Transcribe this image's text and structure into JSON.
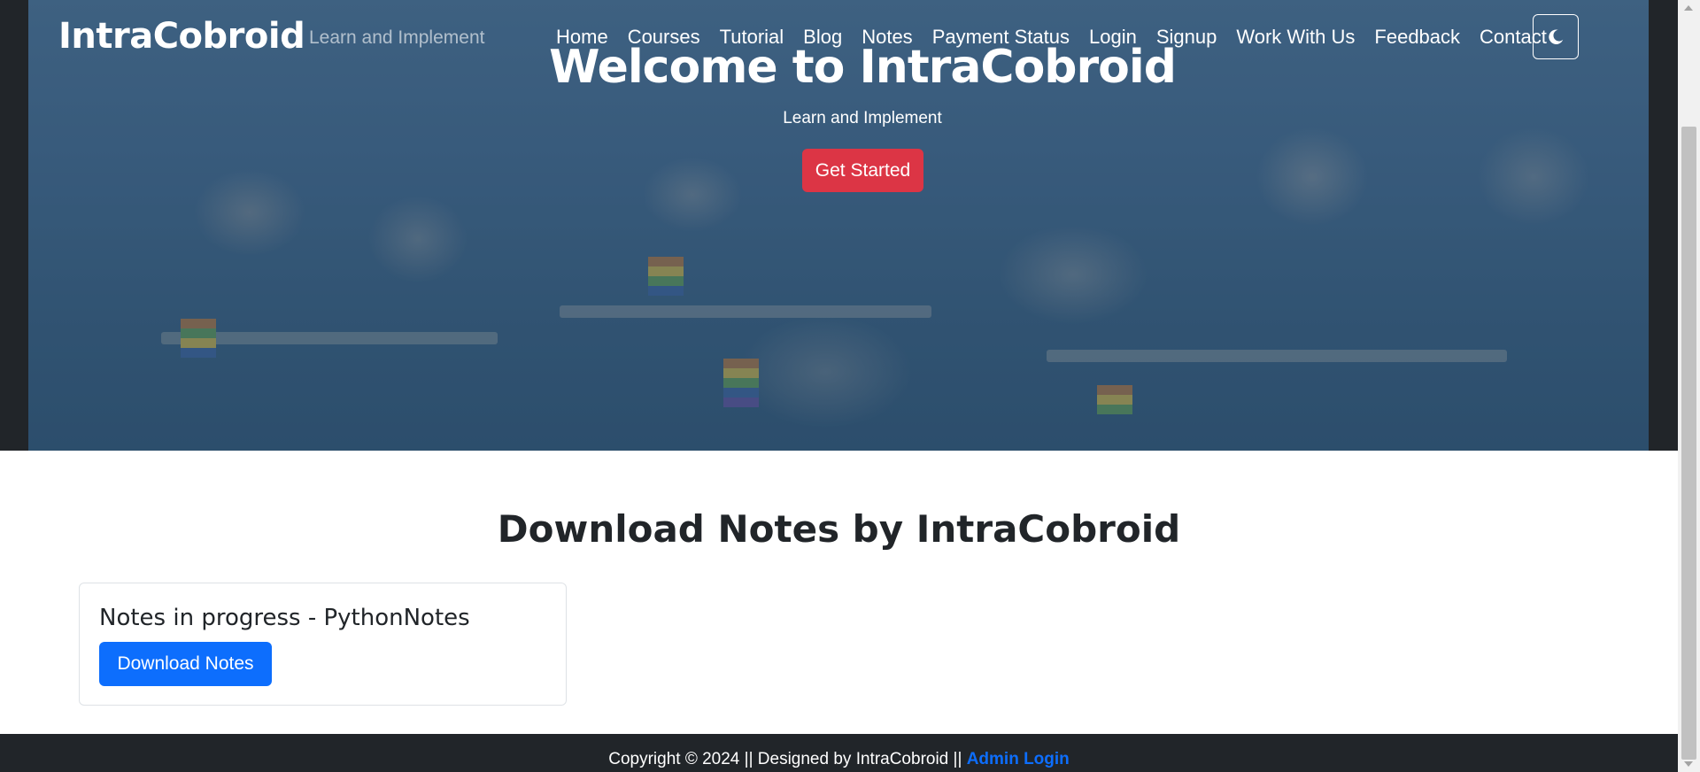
{
  "navbar": {
    "brand": "IntraCobroid",
    "tagline": "Learn and Implement",
    "links": [
      "Home",
      "Courses",
      "Tutorial",
      "Blog",
      "Notes",
      "Payment Status",
      "Login",
      "Signup",
      "Work With Us",
      "Feedback",
      "Contact"
    ],
    "theme_toggle_icon": "moon-icon"
  },
  "hero": {
    "title": "Welcome to IntraCobroid",
    "subtitle": "Learn and Implement",
    "cta_label": "Get Started",
    "cta_color": "#dc3545",
    "background_image": "classroom-children-photo"
  },
  "main": {
    "section_title": "Download Notes by IntraCobroid",
    "card": {
      "title": "Notes in progress - PythonNotes",
      "button_label": "Download Notes",
      "button_color": "#0d6efd"
    }
  },
  "footer": {
    "text": "Copyright © 2024 || Designed by IntraCobroid ||",
    "admin_link": "Admin Login"
  },
  "colors": {
    "dark": "#212529",
    "hero_tint": "#3f5f7c",
    "primary": "#0d6efd",
    "danger": "#dc3545"
  }
}
